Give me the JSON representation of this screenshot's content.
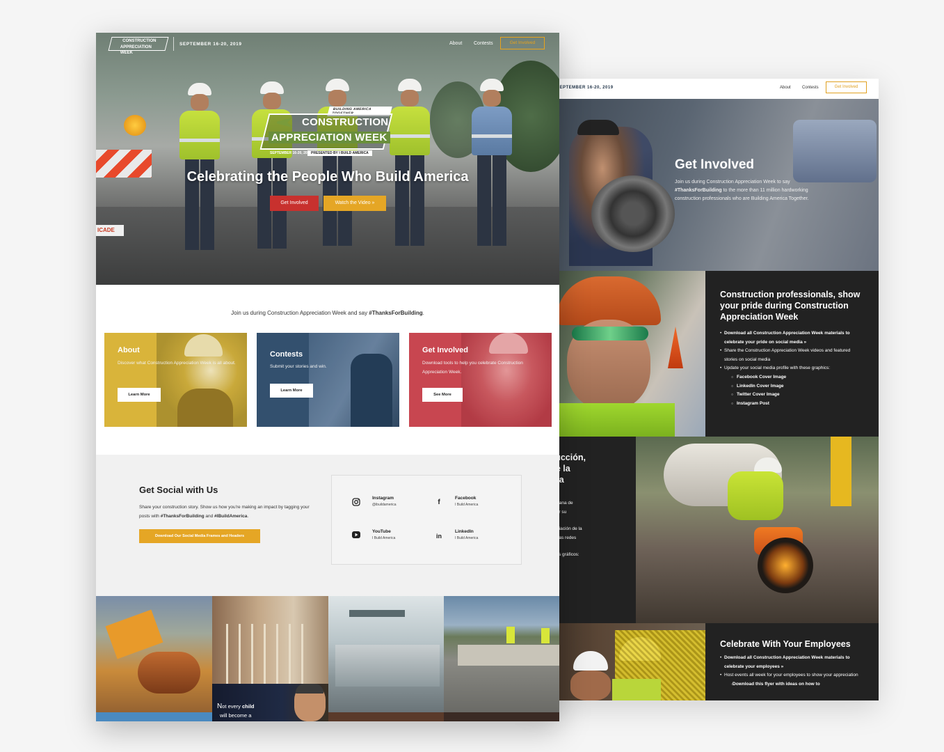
{
  "front": {
    "nav": {
      "logo_line1": "CONSTRUCTION",
      "logo_line2": "APPRECIATION WEEK",
      "date": "SEPTEMBER 16-20, 2019",
      "about": "About",
      "contests": "Contests",
      "cta": "Get Involved"
    },
    "hero": {
      "logo_tag": "BUILDING AMERICA TOGETHER",
      "logo_word1": "CONSTRUCTION",
      "logo_word2": "APPRECIATION WEEK",
      "logo_date": "SEPTEMBER 16-20, 2019",
      "logo_presented": "PRESENTED BY I BUILD AMERICA",
      "sign_text": "ICADE",
      "title": "Celebrating the People Who Build America",
      "btn_primary": "Get Involved",
      "btn_secondary": "Watch the Video »"
    },
    "intro": {
      "text": "Join us during Construction Appreciation Week and say ",
      "hashtag": "#ThanksForBuilding",
      "end": "."
    },
    "cards": [
      {
        "title": "About",
        "text": "Discover what Construction Appreciation Week is all about.",
        "button": "Learn More",
        "color": "#d9b43a"
      },
      {
        "title": "Contests",
        "text": "Submit your stories and win.",
        "button": "Learn More",
        "color": "#33506e"
      },
      {
        "title": "Get Involved",
        "text": "Download tools to help you celebrate Construction Appreciation Week.",
        "button": "See More",
        "color": "#c84650"
      }
    ],
    "social": {
      "title": "Get Social with Us",
      "desc_start": "Share your construction story. Show us how you're making an impact by tagging your posts with ",
      "hashtag1": "#ThanksForBuilding",
      "desc_mid": " and ",
      "hashtag2": "#IBuildAmerica",
      "desc_end": ".",
      "download": "Download Our Social Media Frames and Headers",
      "items": [
        {
          "icon": "instagram-icon",
          "name": "Instagram",
          "handle": "@ibuildamerica"
        },
        {
          "icon": "facebook-icon",
          "name": "Facebook",
          "handle": "I Build America"
        },
        {
          "icon": "youtube-icon",
          "name": "YouTube",
          "handle": "I Build America"
        },
        {
          "icon": "linkedin-icon",
          "name": "LinkedIn",
          "handle": "I Build America"
        }
      ]
    },
    "gallery": {
      "caption_line1_big": "N",
      "caption_line1": "ot every ",
      "caption_bold": "child",
      "caption_line2": "will become a"
    }
  },
  "back": {
    "nav": {
      "date": "SEPTEMBER 16-20, 2019",
      "about": "About",
      "contests": "Contests",
      "cta": "Get Involved"
    },
    "hero": {
      "title": "Get Involved",
      "text_start": "Join us during Construction Appreciation Week to say ",
      "hashtag": "#ThanksForBuilding",
      "text_end": " to the more than 11 million hardworking construction professionals who are Building America Together."
    },
    "section1": {
      "title": "Construction professionals, show your pride during Construction Appreciation Week",
      "items": [
        {
          "text": "Download all Construction Appreciation Week materials to celebrate your pride on social media »",
          "bold": true
        },
        {
          "text": "Share the Construction Appreciation Week videos and featured stories on social media",
          "bold": false
        },
        {
          "text": "Update your social media profile with these graphics:",
          "bold": false
        }
      ],
      "subitems": [
        "Facebook Cover Image",
        "LinkedIn Cover Image",
        "Twitter Cover Image",
        "Instagram Post"
      ]
    },
    "section2": {
      "title_lines": [
        "construcción,",
        "durante la",
        "ión de la"
      ],
      "lines": [
        "n sobre la Semana de",
        "n, para celebrar su",
        "",
        "mana de Apreciación de la",
        "esalientes, en las redes",
        "",
        "ciales con estos gráficos:",
        "acebook",
        "nkedin",
        "witter",
        "am"
      ]
    },
    "section3": {
      "title": "Celebrate With Your Employees",
      "items": [
        {
          "text": "Download all Construction Appreciation Week materials to celebrate your employees »",
          "bold": true
        },
        {
          "text": "Host events all week for your employees to show your appreciation",
          "bold": false
        }
      ],
      "subitem": "Download this flyer with ideas on how to"
    }
  }
}
